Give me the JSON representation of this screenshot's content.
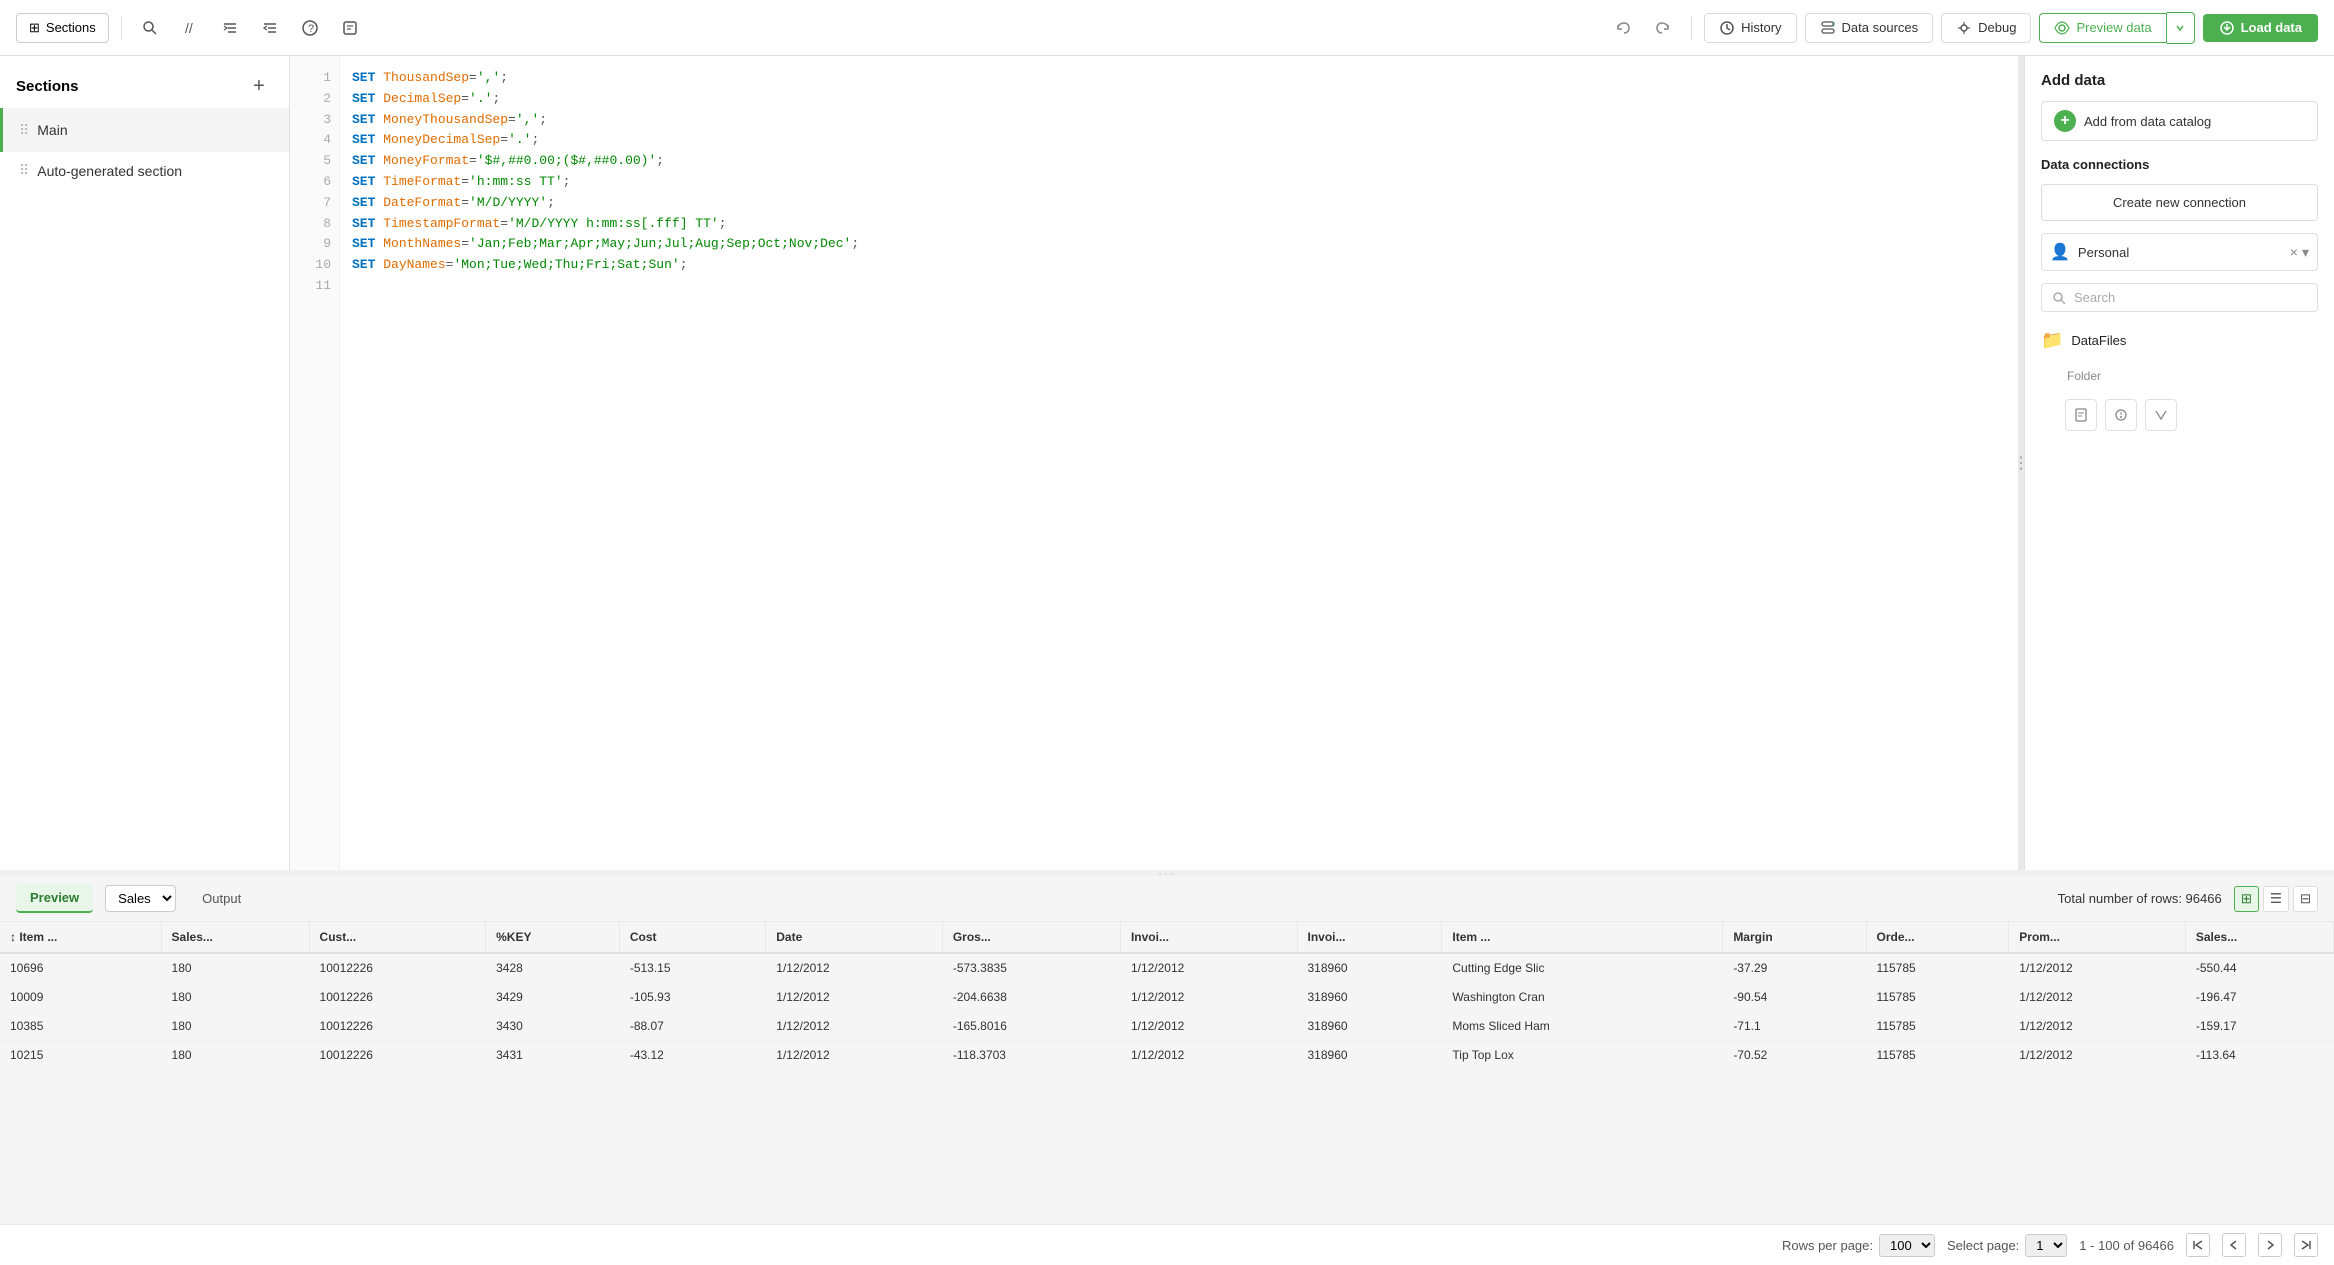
{
  "toolbar": {
    "sections_label": "Sections",
    "history_label": "History",
    "data_sources_label": "Data sources",
    "debug_label": "Debug",
    "preview_data_label": "Preview data",
    "load_data_label": "Load data"
  },
  "sidebar": {
    "title": "Sections",
    "add_tooltip": "+",
    "items": [
      {
        "label": "Main",
        "active": true
      },
      {
        "label": "Auto-generated section",
        "active": false
      }
    ]
  },
  "code_lines": [
    {
      "num": "1",
      "code": "SET ThousandSep=',';",
      "parts": [
        {
          "type": "kw",
          "text": "SET"
        },
        {
          "type": "var",
          "text": " ThousandSep"
        },
        {
          "type": "punc",
          "text": "="
        },
        {
          "type": "str",
          "text": "','"
        },
        {
          "type": "punc",
          "text": ";"
        }
      ]
    },
    {
      "num": "2",
      "code": "SET DecimalSep='.';",
      "parts": [
        {
          "type": "kw",
          "text": "SET"
        },
        {
          "type": "var",
          "text": " DecimalSep"
        },
        {
          "type": "punc",
          "text": "="
        },
        {
          "type": "str",
          "text": "'.'"
        },
        {
          "type": "punc",
          "text": ";"
        }
      ]
    },
    {
      "num": "3",
      "code": "SET MoneyThousandSep=',';",
      "parts": [
        {
          "type": "kw",
          "text": "SET"
        },
        {
          "type": "var",
          "text": " MoneyThousandSep"
        },
        {
          "type": "punc",
          "text": "="
        },
        {
          "type": "str",
          "text": "','"
        },
        {
          "type": "punc",
          "text": ";"
        }
      ]
    },
    {
      "num": "4",
      "code": "SET MoneyDecimalSep='.';",
      "parts": [
        {
          "type": "kw",
          "text": "SET"
        },
        {
          "type": "var",
          "text": " MoneyDecimalSep"
        },
        {
          "type": "punc",
          "text": "="
        },
        {
          "type": "str",
          "text": "'.'"
        },
        {
          "type": "punc",
          "text": ";"
        }
      ]
    },
    {
      "num": "5",
      "code": "SET MoneyFormat='$#,##0.00;($#,##0.00)';",
      "parts": [
        {
          "type": "kw",
          "text": "SET"
        },
        {
          "type": "var",
          "text": " MoneyFormat"
        },
        {
          "type": "punc",
          "text": "="
        },
        {
          "type": "str",
          "text": "'$#,##0.00;($#,##0.00)'"
        },
        {
          "type": "punc",
          "text": ";"
        }
      ]
    },
    {
      "num": "6",
      "code": "SET TimeFormat='h:mm:ss TT';",
      "parts": [
        {
          "type": "kw",
          "text": "SET"
        },
        {
          "type": "var",
          "text": " TimeFormat"
        },
        {
          "type": "punc",
          "text": "="
        },
        {
          "type": "str",
          "text": "'h:mm:ss TT'"
        },
        {
          "type": "punc",
          "text": ";"
        }
      ]
    },
    {
      "num": "7",
      "code": "SET DateFormat='M/D/YYYY';",
      "parts": [
        {
          "type": "kw",
          "text": "SET"
        },
        {
          "type": "var",
          "text": " DateFormat"
        },
        {
          "type": "punc",
          "text": "="
        },
        {
          "type": "str",
          "text": "'M/D/YYYY'"
        },
        {
          "type": "punc",
          "text": ";"
        }
      ]
    },
    {
      "num": "8",
      "code": "SET TimestampFormat='M/D/YYYY h:mm:ss[.fff] TT';",
      "parts": [
        {
          "type": "kw",
          "text": "SET"
        },
        {
          "type": "var",
          "text": " TimestampFormat"
        },
        {
          "type": "punc",
          "text": "="
        },
        {
          "type": "str",
          "text": "'M/D/YYYY h:mm:ss[.fff] TT'"
        },
        {
          "type": "punc",
          "text": ";"
        }
      ]
    },
    {
      "num": "9",
      "code": "SET MonthNames='Jan;Feb;Mar;Apr;May;Jun;Jul;Aug;Sep;Oct;Nov;Dec';",
      "parts": [
        {
          "type": "kw",
          "text": "SET"
        },
        {
          "type": "var",
          "text": " MonthNames"
        },
        {
          "type": "punc",
          "text": "="
        },
        {
          "type": "str",
          "text": "'Jan;Feb;Mar;Apr;May;Jun;Jul;Aug;Sep;Oct;Nov;Dec'"
        },
        {
          "type": "punc",
          "text": ";"
        }
      ]
    },
    {
      "num": "10",
      "code": "SET DayNames='Mon;Tue;Wed;Thu;Fri;Sat;Sun';",
      "parts": [
        {
          "type": "kw",
          "text": "SET"
        },
        {
          "type": "var",
          "text": " DayNames"
        },
        {
          "type": "punc",
          "text": "="
        },
        {
          "type": "str",
          "text": "'Mon;Tue;Wed;Thu;Fri;Sat;Sun'"
        },
        {
          "type": "punc",
          "text": ";"
        }
      ]
    },
    {
      "num": "11",
      "code": "",
      "parts": []
    }
  ],
  "right_panel": {
    "add_data_title": "Add data",
    "add_from_catalog_label": "Add from data catalog",
    "data_connections_title": "Data connections",
    "create_connection_label": "Create new connection",
    "personal_label": "Personal",
    "search_placeholder": "Search",
    "datafiles_label": "DataFiles",
    "folder_label": "Folder"
  },
  "preview": {
    "tab_label": "Preview",
    "output_tab_label": "Output",
    "table_select": "Sales",
    "total_rows_label": "Total number of rows: 96466",
    "columns": [
      "Item ...",
      "Sales...",
      "Cust...",
      "%KEY",
      "Cost",
      "Date",
      "Gros...",
      "Invoi...",
      "Invoi...",
      "Item ...",
      "Margin",
      "Orde...",
      "Prom...",
      "Sales..."
    ],
    "rows": [
      [
        "10696",
        "180",
        "10012226",
        "3428",
        "-513.15",
        "1/12/2012",
        "-573.3835",
        "1/12/2012",
        "318960",
        "Cutting Edge Slic",
        "-37.29",
        "115785",
        "1/12/2012",
        "-550.44"
      ],
      [
        "10009",
        "180",
        "10012226",
        "3429",
        "-105.93",
        "1/12/2012",
        "-204.6638",
        "1/12/2012",
        "318960",
        "Washington Cran",
        "-90.54",
        "115785",
        "1/12/2012",
        "-196.47"
      ],
      [
        "10385",
        "180",
        "10012226",
        "3430",
        "-88.07",
        "1/12/2012",
        "-165.8016",
        "1/12/2012",
        "318960",
        "Moms Sliced Ham",
        "-71.1",
        "115785",
        "1/12/2012",
        "-159.17"
      ],
      [
        "10215",
        "180",
        "10012226",
        "3431",
        "-43.12",
        "1/12/2012",
        "-118.3703",
        "1/12/2012",
        "318960",
        "Tip Top Lox",
        "-70.52",
        "115785",
        "1/12/2012",
        "-113.64"
      ]
    ]
  },
  "pagination": {
    "rows_per_page_label": "Rows per page:",
    "rows_per_page_value": "100",
    "select_page_label": "Select page:",
    "page_value": "1",
    "page_info": "1 - 100 of 96466"
  }
}
